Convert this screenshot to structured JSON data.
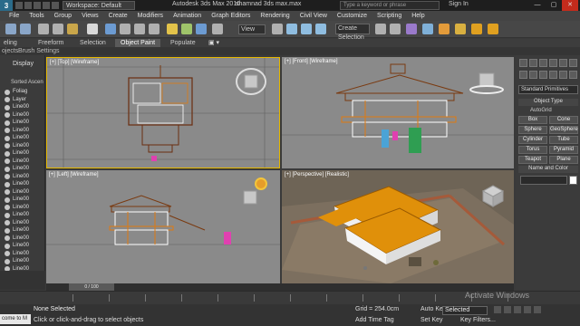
{
  "window": {
    "logo": "3",
    "workspace_label": "Workspace: Default",
    "app_title": "Autodesk 3ds Max 2016",
    "file_name": "shamnad 3ds max.max",
    "search_placeholder": "Type a keyword or phrase",
    "sign_in": "Sign In",
    "controls": [
      "—",
      "▢",
      "✕"
    ]
  },
  "menu": [
    "File",
    "Tools",
    "Group",
    "Views",
    "Create",
    "Modifiers",
    "Animation",
    "Graph Editors",
    "Rendering",
    "Civil View",
    "Customize",
    "Scripting",
    "Help"
  ],
  "toolbar": {
    "view_dropdown": "View",
    "selection_set": "Create Selection Se"
  },
  "ribbon": {
    "tabs": [
      "eling",
      "Freeform",
      "Selection",
      "Object Paint",
      "Populate"
    ],
    "active": "Object Paint",
    "subtabs": [
      "ojects",
      "Brush Settings"
    ]
  },
  "scene_explorer": {
    "display_label": "Display",
    "sorted_label": "Sorted Ascen",
    "items": [
      "Foliag",
      "Layer",
      "Line00",
      "Line00",
      "Line00",
      "Line00",
      "Line00",
      "Line00",
      "Line00",
      "Line00",
      "Line00",
      "Line00",
      "Line00",
      "Line00",
      "Line00",
      "Line00",
      "Line00",
      "Line00",
      "Line00",
      "Line00",
      "Line00",
      "Line00",
      "Line00",
      "Line00",
      "Line00",
      "Line00"
    ]
  },
  "viewports": {
    "top": "[+] [Top] [Wireframe]",
    "front": "[+] [Front] [Wireframe]",
    "left": "[+] [Left] [Wireframe]",
    "perspective": "[+] [Perspective] [Realistic]"
  },
  "command_panel": {
    "category": "Standard Primitives",
    "object_type_header": "Object Type",
    "autogrid": "AutoGrid",
    "primitives": [
      "Box",
      "Cone",
      "Sphere",
      "GeoSphere",
      "Cylinder",
      "Tube",
      "Torus",
      "Pyramid",
      "Teapot",
      "Plane"
    ],
    "name_color_header": "Name and Color"
  },
  "timeline": {
    "frame": "0 / 100"
  },
  "status": {
    "script_label": "come to M",
    "line1": "None Selected",
    "line2": "Click or click-and-drag to select objects",
    "grid": "Grid = 254.0cm",
    "add_time_tag": "Add Time Tag",
    "auto_key": "Auto Key",
    "set_key": "Set Key",
    "selected_dropdown": "Selected",
    "key_filters": "Key Filters...",
    "watermark": "Activate Windows"
  },
  "colors": {
    "active_viewport_border": "#e6b800",
    "roof_orange": "#e08a00",
    "wire_brown": "#7a3a10",
    "ground": "#6e6456"
  },
  "icons": [
    "3ds-max-logo",
    "search-icon",
    "help-icon",
    "undo-icon",
    "redo-icon",
    "select-icon",
    "move-icon",
    "rotate-icon",
    "scale-icon",
    "snap-icon",
    "render-icon",
    "navcube-icon",
    "play-icon"
  ]
}
